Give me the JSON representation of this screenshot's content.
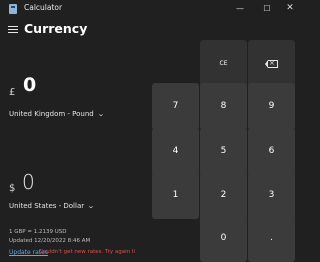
{
  "app": {
    "title": "Calculator"
  },
  "window": {
    "minimize": "—",
    "maximize": "☐",
    "close": "✕"
  },
  "mode": {
    "title": "Currency"
  },
  "input": {
    "symbol": "£",
    "value": "0",
    "unit": "United Kingdom - Pound"
  },
  "output": {
    "symbol": "$",
    "value": "0",
    "unit": "United States - Dollar"
  },
  "info": {
    "rate": "1 GBP = 1.2139 USD",
    "updated": "Updated 12/20/2022 8:46 AM",
    "update_link": "Update rates",
    "error": "Couldn't get new rates. Try again li"
  },
  "keys": {
    "ce": "CE",
    "k7": "7",
    "k8": "8",
    "k9": "9",
    "k4": "4",
    "k5": "5",
    "k6": "6",
    "k1": "1",
    "k2": "2",
    "k3": "3",
    "k0": "0",
    "dot": "."
  },
  "icons": {
    "menu": "hamburger-icon",
    "backspace": "backspace-icon",
    "dropdown": "chevron-down-icon"
  },
  "colors": {
    "background": "#202020",
    "key_number": "#3b3b3b",
    "key_function": "#323232",
    "link": "#5fa8ea",
    "error": "#e0504c"
  }
}
